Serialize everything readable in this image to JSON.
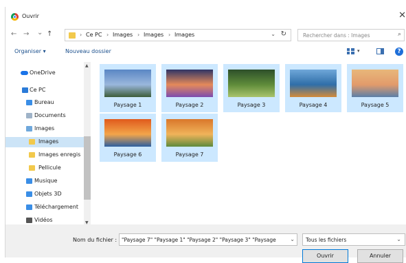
{
  "window": {
    "title": "Ouvrir",
    "close_glyph": "✕"
  },
  "nav": {
    "back": "←",
    "forward": "→",
    "recent": "⌄",
    "up": "↑",
    "breadcrumbs": [
      "Ce PC",
      "Images",
      "Images",
      "Images"
    ],
    "separator": "›",
    "addr_dropdown": "⌄",
    "refresh": "↻",
    "search_placeholder": "Rechercher dans : Images"
  },
  "toolbar": {
    "organize": "Organiser ▾",
    "new_folder": "Nouveau dossier"
  },
  "sidebar": {
    "items": [
      {
        "label": "OneDrive",
        "icon": "cloud-icon",
        "color": "#1a73e8"
      },
      {
        "label": "Ce PC",
        "icon": "computer-icon",
        "color": "#2b7bd8"
      },
      {
        "label": "Bureau",
        "icon": "desktop-folder-icon",
        "color": "#3a8ee6"
      },
      {
        "label": "Documents",
        "icon": "documents-icon",
        "color": "#9fb3c8"
      },
      {
        "label": "Images",
        "icon": "pictures-icon",
        "color": "#6fa8dc"
      },
      {
        "label": "Images",
        "icon": "folder-icon",
        "color": "#f2c94c"
      },
      {
        "label": "Images enregis",
        "icon": "folder-icon",
        "color": "#f2c94c"
      },
      {
        "label": "Pellicule",
        "icon": "folder-icon",
        "color": "#f2c94c"
      },
      {
        "label": "Musique",
        "icon": "music-icon",
        "color": "#3a8ee6"
      },
      {
        "label": "Objets 3D",
        "icon": "objects3d-icon",
        "color": "#3a8ee6"
      },
      {
        "label": "Téléchargement",
        "icon": "downloads-icon",
        "color": "#3a8ee6"
      },
      {
        "label": "Vidéos",
        "icon": "videos-icon",
        "color": "#555555"
      }
    ],
    "selected_index": 5
  },
  "files": [
    {
      "name": "Paysage 1",
      "palette": [
        "#5a86c4",
        "#9ab7dc",
        "#3c5d3a"
      ]
    },
    {
      "name": "Paysage 2",
      "palette": [
        "#2f3566",
        "#e58a5a",
        "#7c4cb0"
      ]
    },
    {
      "name": "Paysage 3",
      "palette": [
        "#2d4f2a",
        "#5f8c3a",
        "#a9c46d"
      ]
    },
    {
      "name": "Paysage 4",
      "palette": [
        "#6fa7d9",
        "#2f6ea8",
        "#d38b3a"
      ]
    },
    {
      "name": "Paysage 5",
      "palette": [
        "#e8b77a",
        "#e29b6b",
        "#5b7fa8"
      ]
    },
    {
      "name": "Paysage 6",
      "palette": [
        "#e05a1c",
        "#f2a54a",
        "#2c5fa0"
      ]
    },
    {
      "name": "Paysage 7",
      "palette": [
        "#d9772b",
        "#f0b35a",
        "#5e8a3c"
      ]
    }
  ],
  "footer": {
    "filename_label": "Nom du fichier :",
    "filename_value": "\"Paysage 7\" \"Paysage 1\" \"Paysage 2\" \"Paysage 3\" \"Paysage",
    "filename_dropdown": "⌄",
    "filetype": "Tous les fichiers",
    "filetype_dropdown": "⌄",
    "open": "Ouvrir",
    "cancel": "Annuler"
  }
}
